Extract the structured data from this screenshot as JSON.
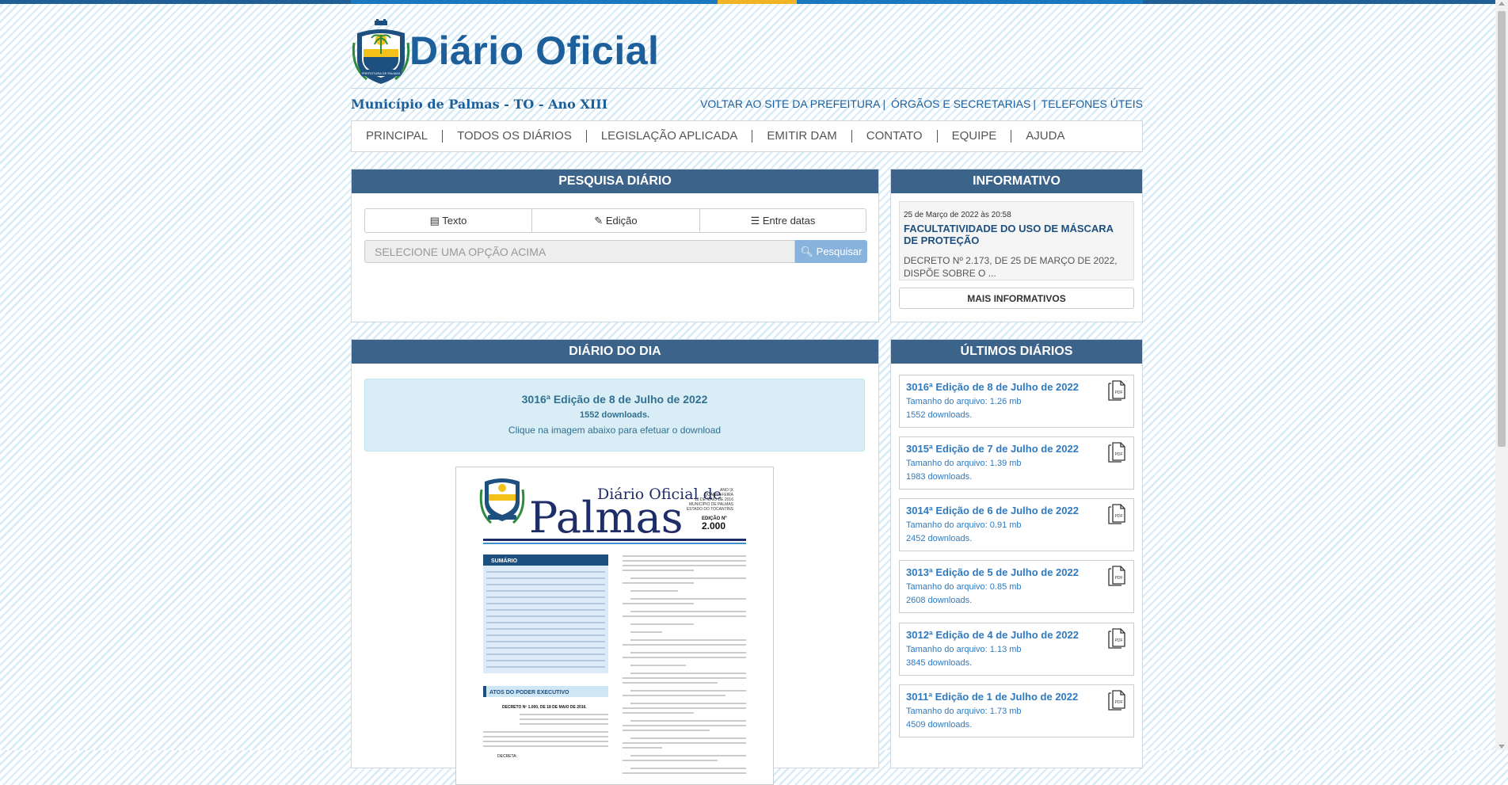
{
  "header": {
    "title": "Diário Oficial",
    "subtitle": "Município de Palmas - TO - Ano XIII",
    "crest_text": "PREFEITURA DE PALMAS",
    "links": [
      "VOLTAR AO SITE DA PREFEITURA",
      "ÓRGÃOS E SECRETARIAS",
      "TELEFONES ÚTEIS"
    ]
  },
  "nav": [
    "PRINCIPAL",
    "TODOS OS DIÁRIOS",
    "LEGISLAÇÃO APLICADA",
    "EMITIR DAM",
    "CONTATO",
    "EQUIPE",
    "AJUDA"
  ],
  "search": {
    "heading": "PESQUISA DIÁRIO",
    "options": [
      "Texto",
      "Edição",
      "Entre datas"
    ],
    "placeholder": "SELECIONE UMA OPÇÃO ACIMA",
    "button": "Pesquisar"
  },
  "info": {
    "heading": "INFORMATIVO",
    "date": "25 de Março de 2022 às 20:58",
    "title": "FACULTATIVIDADE DO USO DE MÁSCARA DE PROTEÇÃO",
    "text": "DECRETO Nº 2.173, DE 25 DE MARÇO DE 2022, DISPÕE SOBRE O ...",
    "more": "MAIS INFORMATIVOS"
  },
  "diario_do_dia": {
    "heading": "DIÁRIO DO DIA",
    "edition": "3016ª Edição de 8 de Julho de 2022",
    "downloads": "1552 downloads.",
    "hint": "Clique na imagem abaixo para efetuar o download",
    "cover": {
      "brand_top": "Diário Oficial de",
      "brand_main": "Palmas",
      "meta": [
        "ANO IX",
        "QUARTA-FEIRA",
        "18 DE MAIO DE 2016",
        "MUNICÍPIO DE PALMAS",
        "ESTADO DO TOCANTINS"
      ],
      "edition_label": "EDIÇÃO Nº",
      "edition_no": "2.000",
      "sumario": "SUMÁRIO",
      "atos": "ATOS DO PODER EXECUTIVO",
      "decreto": "DECRETO Nº 1.000, DE 18 DE MAIO DE 2016.",
      "decreta": "DECRETA:"
    }
  },
  "ultimos": {
    "heading": "ÚLTIMOS DIÁRIOS",
    "items": [
      {
        "title": "3016ª Edição de 8 de Julho de 2022",
        "size": "Tamanho do arquivo: 1.26 mb",
        "downloads": "1552 downloads."
      },
      {
        "title": "3015ª Edição de 7 de Julho de 2022",
        "size": "Tamanho do arquivo: 1.39 mb",
        "downloads": "1983 downloads."
      },
      {
        "title": "3014ª Edição de 6 de Julho de 2022",
        "size": "Tamanho do arquivo: 0.91 mb",
        "downloads": "2452 downloads."
      },
      {
        "title": "3013ª Edição de 5 de Julho de 2022",
        "size": "Tamanho do arquivo: 0.85 mb",
        "downloads": "2608 downloads."
      },
      {
        "title": "3012ª Edição de 4 de Julho de 2022",
        "size": "Tamanho do arquivo: 1.13 mb",
        "downloads": "3845 downloads."
      },
      {
        "title": "3011ª Edição de 1 de Julho de 2022",
        "size": "Tamanho do arquivo: 1.73 mb",
        "downloads": "4509 downloads."
      }
    ]
  },
  "colors": {
    "brand_blue": "#1d5f9b",
    "panel_header": "#3c6389",
    "accent_gold": "#f2b325",
    "link_blue": "#2f7abf"
  }
}
